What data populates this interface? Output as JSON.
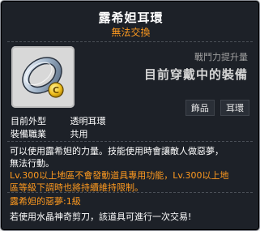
{
  "item": {
    "name": "露希妲耳環",
    "trade_status": "無法交換"
  },
  "header_right": {
    "stat_label": "戰鬥力提升量",
    "equipped_text": "目前穿戴中的裝備"
  },
  "icon": {
    "name": "ring-earring-icon",
    "coin_symbol": "C"
  },
  "tags": [
    "飾品",
    "耳環"
  ],
  "attributes": [
    {
      "key": "目前外型",
      "value": "透明耳環"
    },
    {
      "key": "裝備職業",
      "value": "共用"
    }
  ],
  "description": {
    "line1": "可以使用露希妲的力量。技能使用時會讓敵人做惡夢，",
    "line2": "無法行動。",
    "line3": "Lv.300以上地區不會發動道具專用功能，Lv.300以上地",
    "line4": "區等級下調時也將持續維持限制。"
  },
  "skill": {
    "name_line": "露希妲的惡夢:1級",
    "detail": "若使用水晶神奇剪刀，該道具可進行一次交易!"
  },
  "colors": {
    "background": "#1d2128",
    "accent_orange": "#ff9a1f",
    "text_white": "#ffffff",
    "text_gray": "#a0a0a0"
  }
}
